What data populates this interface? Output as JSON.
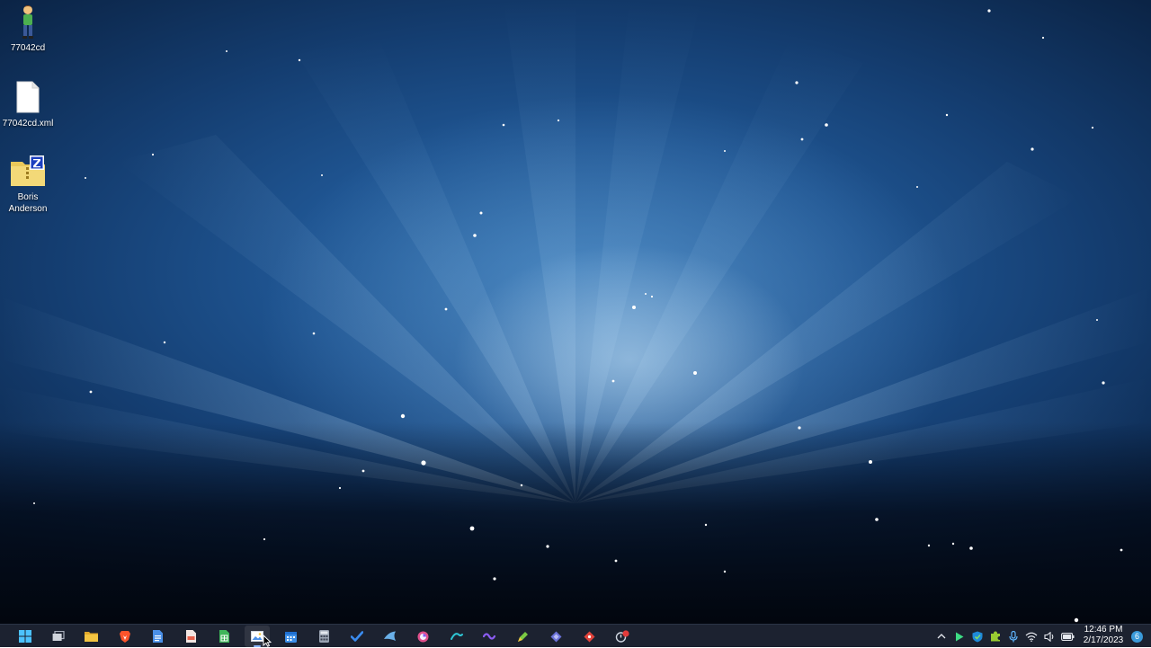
{
  "desktop": {
    "wallpaper": "blue-aurora-starfield",
    "accent_colors": [
      "#1f5592",
      "#143d70",
      "#c8e4f8"
    ],
    "icons": [
      {
        "label": "77042cd",
        "icon": "character-figure-icon"
      },
      {
        "label": "77042cd.xml",
        "icon": "blank-document-icon"
      },
      {
        "label": "Boris Anderson",
        "icon": "zip-folder-icon"
      }
    ]
  },
  "taskbar": {
    "apps": [
      {
        "id": "start",
        "icon": "windows-logo-icon",
        "color": "#4cc2ff"
      },
      {
        "id": "task-view",
        "icon": "task-view-icon",
        "color": "#d0d4dc"
      },
      {
        "id": "file-explorer",
        "icon": "folder-icon",
        "color": "#f4c542"
      },
      {
        "id": "brave",
        "icon": "brave-lion-icon",
        "color": "#fb542b"
      },
      {
        "id": "docs",
        "icon": "blue-document-icon",
        "color": "#4a8fe7"
      },
      {
        "id": "pdf",
        "icon": "red-document-icon",
        "color": "#e8624c"
      },
      {
        "id": "sheets",
        "icon": "green-spreadsheet-icon",
        "color": "#3fb55a"
      },
      {
        "id": "image-viewer",
        "icon": "picture-icon",
        "color": "#cfd6e0",
        "active": true
      },
      {
        "id": "calendar",
        "icon": "calendar-icon",
        "color": "#3b8ee8"
      },
      {
        "id": "calculator",
        "icon": "calculator-icon",
        "color": "#9aa3b2"
      },
      {
        "id": "todo",
        "icon": "checkmark-icon",
        "color": "#3a8cf0"
      },
      {
        "id": "steam",
        "icon": "steam-icon",
        "color": "#6ab0e8"
      },
      {
        "id": "color-app",
        "icon": "color-circle-icon",
        "color": "#e0508c"
      },
      {
        "id": "arc",
        "icon": "arc-swirl-icon",
        "color": "#2ec5d3"
      },
      {
        "id": "voice",
        "icon": "purple-swirl-icon",
        "color": "#8a5cf0"
      },
      {
        "id": "pen-tool",
        "icon": "green-pen-icon",
        "color": "#7ac943"
      },
      {
        "id": "vpn",
        "icon": "diamond-shield-icon",
        "color": "#6b72d9"
      },
      {
        "id": "red-app",
        "icon": "red-diamond-icon",
        "color": "#e0433b"
      },
      {
        "id": "badge-app",
        "icon": "record-badge-icon",
        "color": "#e33b3b"
      }
    ],
    "tray": {
      "icons": [
        {
          "id": "overflow",
          "icon": "chevron-up-icon"
        },
        {
          "id": "play-store",
          "icon": "play-arrow-icon"
        },
        {
          "id": "security",
          "icon": "shield-check-icon"
        },
        {
          "id": "extension",
          "icon": "puzzle-icon"
        },
        {
          "id": "microphone",
          "icon": "microphone-icon"
        },
        {
          "id": "wifi",
          "icon": "wifi-icon"
        },
        {
          "id": "volume",
          "icon": "speaker-icon"
        },
        {
          "id": "battery",
          "icon": "battery-icon"
        }
      ],
      "time": "12:46 PM",
      "date": "2/17/2023",
      "notification_count": "6"
    }
  }
}
